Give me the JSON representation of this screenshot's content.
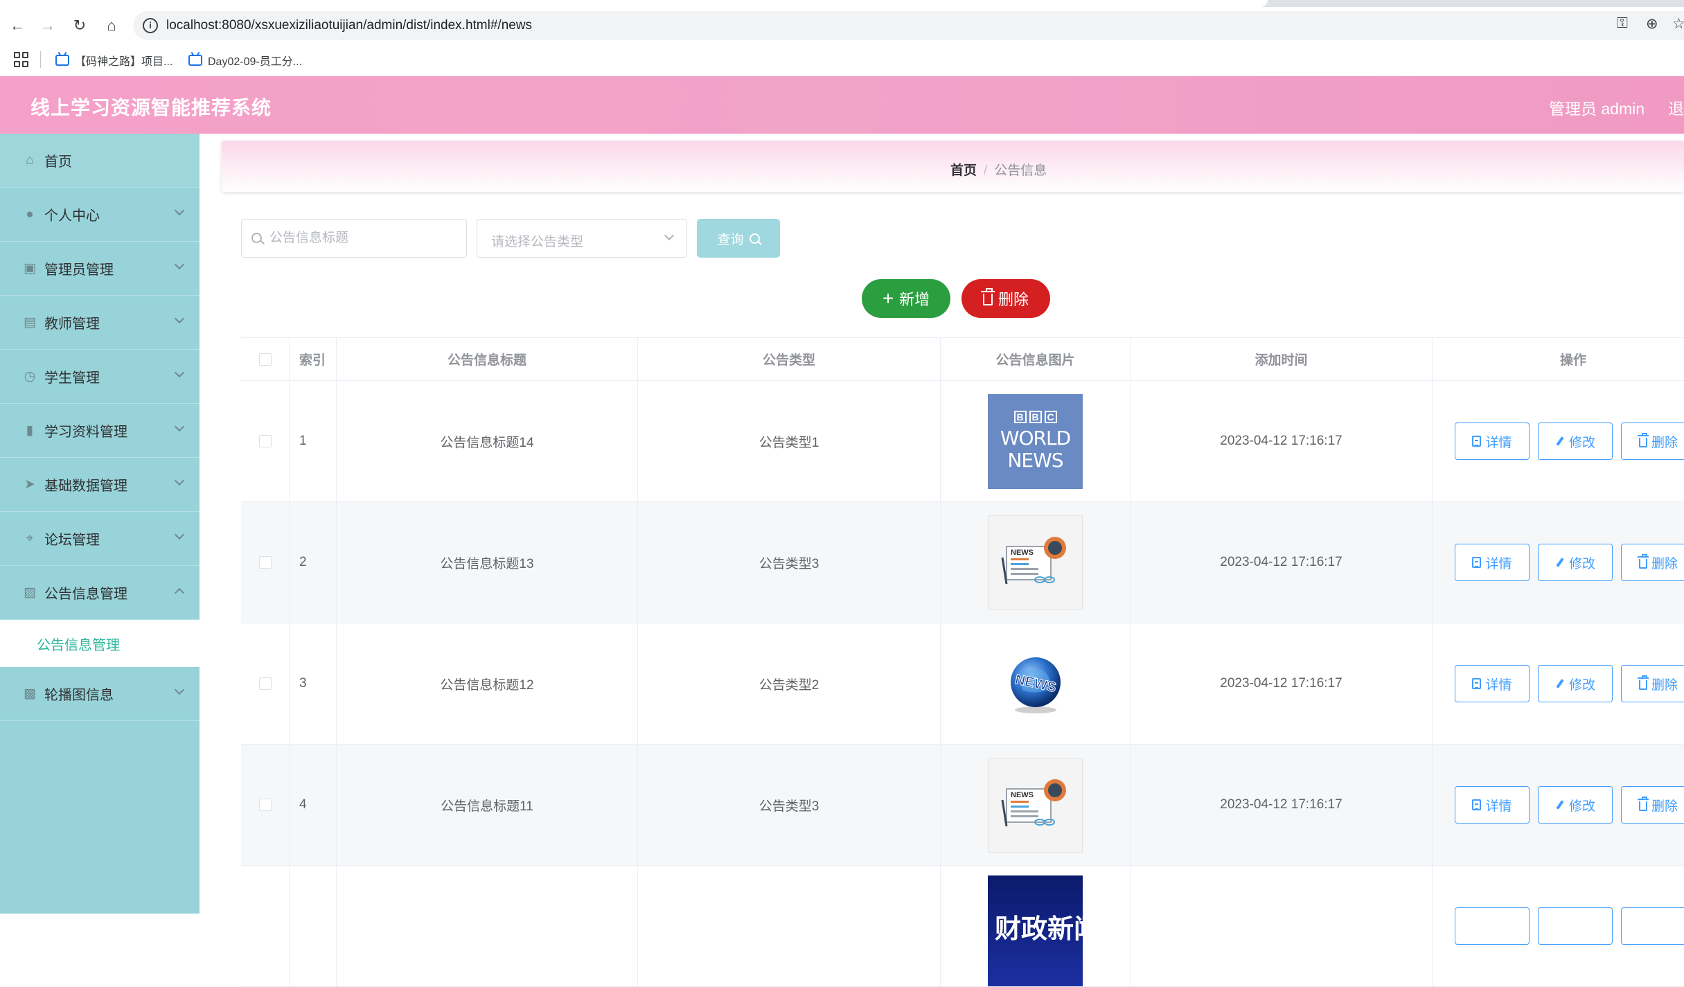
{
  "browser": {
    "url": "localhost:8080/xsxuexiziliaotuijian/admin/dist/index.html#/news",
    "bookmarks": [
      "【码神之路】项目...",
      "Day02-09-员工分..."
    ]
  },
  "header": {
    "title": "线上学习资源智能推荐系统",
    "user": "管理员 admin",
    "logout": "退"
  },
  "sidebar": {
    "items": [
      {
        "label": "首页",
        "icon": "home-icon"
      },
      {
        "label": "个人中心",
        "icon": "user-icon"
      },
      {
        "label": "管理员管理",
        "icon": "briefcase-icon"
      },
      {
        "label": "教师管理",
        "icon": "id-card-icon"
      },
      {
        "label": "学生管理",
        "icon": "clock-icon"
      },
      {
        "label": "学习资料管理",
        "icon": "ticket-icon"
      },
      {
        "label": "基础数据管理",
        "icon": "send-icon"
      },
      {
        "label": "论坛管理",
        "icon": "crop-icon"
      },
      {
        "label": "公告信息管理",
        "icon": "document-icon"
      },
      {
        "label": "轮播图信息",
        "icon": "clipboard-icon"
      }
    ],
    "submenu": {
      "label": "公告信息管理"
    }
  },
  "breadcrumb": {
    "home": "首页",
    "separator": "/",
    "current": "公告信息"
  },
  "search": {
    "title_placeholder": "公告信息标题",
    "type_placeholder": "请选择公告类型",
    "query_label": "查询"
  },
  "actions": {
    "add_label": "新增",
    "delete_label": "删除"
  },
  "table": {
    "columns": [
      "索引",
      "公告信息标题",
      "公告类型",
      "公告信息图片",
      "添加时间",
      "操作"
    ],
    "rows": [
      {
        "index": "1",
        "title": "公告信息标题14",
        "type": "公告类型1",
        "image": "bbc-world-news",
        "time": "2023-04-12 17:16:17"
      },
      {
        "index": "2",
        "title": "公告信息标题13",
        "type": "公告类型3",
        "image": "newspaper",
        "time": "2023-04-12 17:16:17"
      },
      {
        "index": "3",
        "title": "公告信息标题12",
        "type": "公告类型2",
        "image": "news-globe",
        "time": "2023-04-12 17:16:17"
      },
      {
        "index": "4",
        "title": "公告信息标题11",
        "type": "公告类型3",
        "image": "newspaper",
        "time": "2023-04-12 17:16:17"
      }
    ],
    "row_actions": {
      "detail": "详情",
      "edit": "修改",
      "delete": "删除"
    },
    "thumb_text": {
      "bbc_letters": [
        "B",
        "B",
        "C"
      ],
      "bbc_line1": "WORLD",
      "bbc_line2": "NEWS",
      "paper_text": "NEWS",
      "globe_text": "NEWS",
      "partial_text": "财政新闻"
    }
  },
  "colors": {
    "header_pink": "#f2a3c8",
    "sidebar_teal": "#97d3d9",
    "active_text": "#2bb49a",
    "add_green": "#2b9e3f",
    "delete_red": "#d42020",
    "link_blue": "#409eff"
  }
}
